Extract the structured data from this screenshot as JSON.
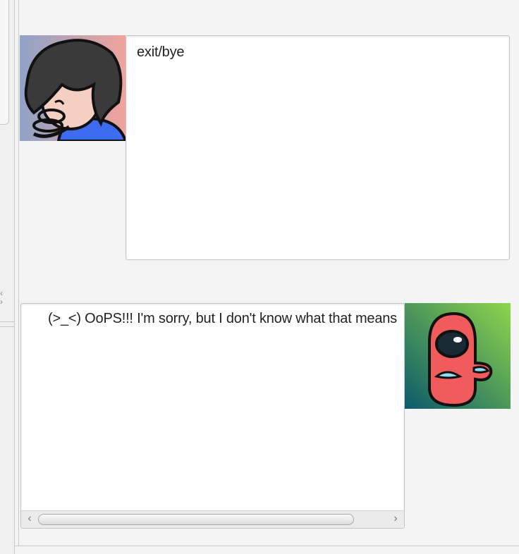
{
  "window": {
    "left_scroll_icon": "chevron-left-icon",
    "right_scroll_icon": "chevron-right-icon"
  },
  "messages": [
    {
      "sender": "user",
      "avatar_icon": "user-avatar-icon",
      "text": "exit/bye"
    },
    {
      "sender": "bot",
      "avatar_icon": "bot-avatar-icon",
      "text": "(>_<) OoPS!!! I'm sorry, but I don't know what that means",
      "scroll_left_glyph": "‹",
      "scroll_right_glyph": "›"
    }
  ],
  "colors": {
    "user_avatar_bg_left": "#8fa3c7",
    "user_avatar_bg_right": "#f1a39c",
    "bot_avatar_bg_left": "#0b5a6b",
    "bot_avatar_bg_right": "#8fd64b",
    "bot_body": "#f05b5b"
  }
}
